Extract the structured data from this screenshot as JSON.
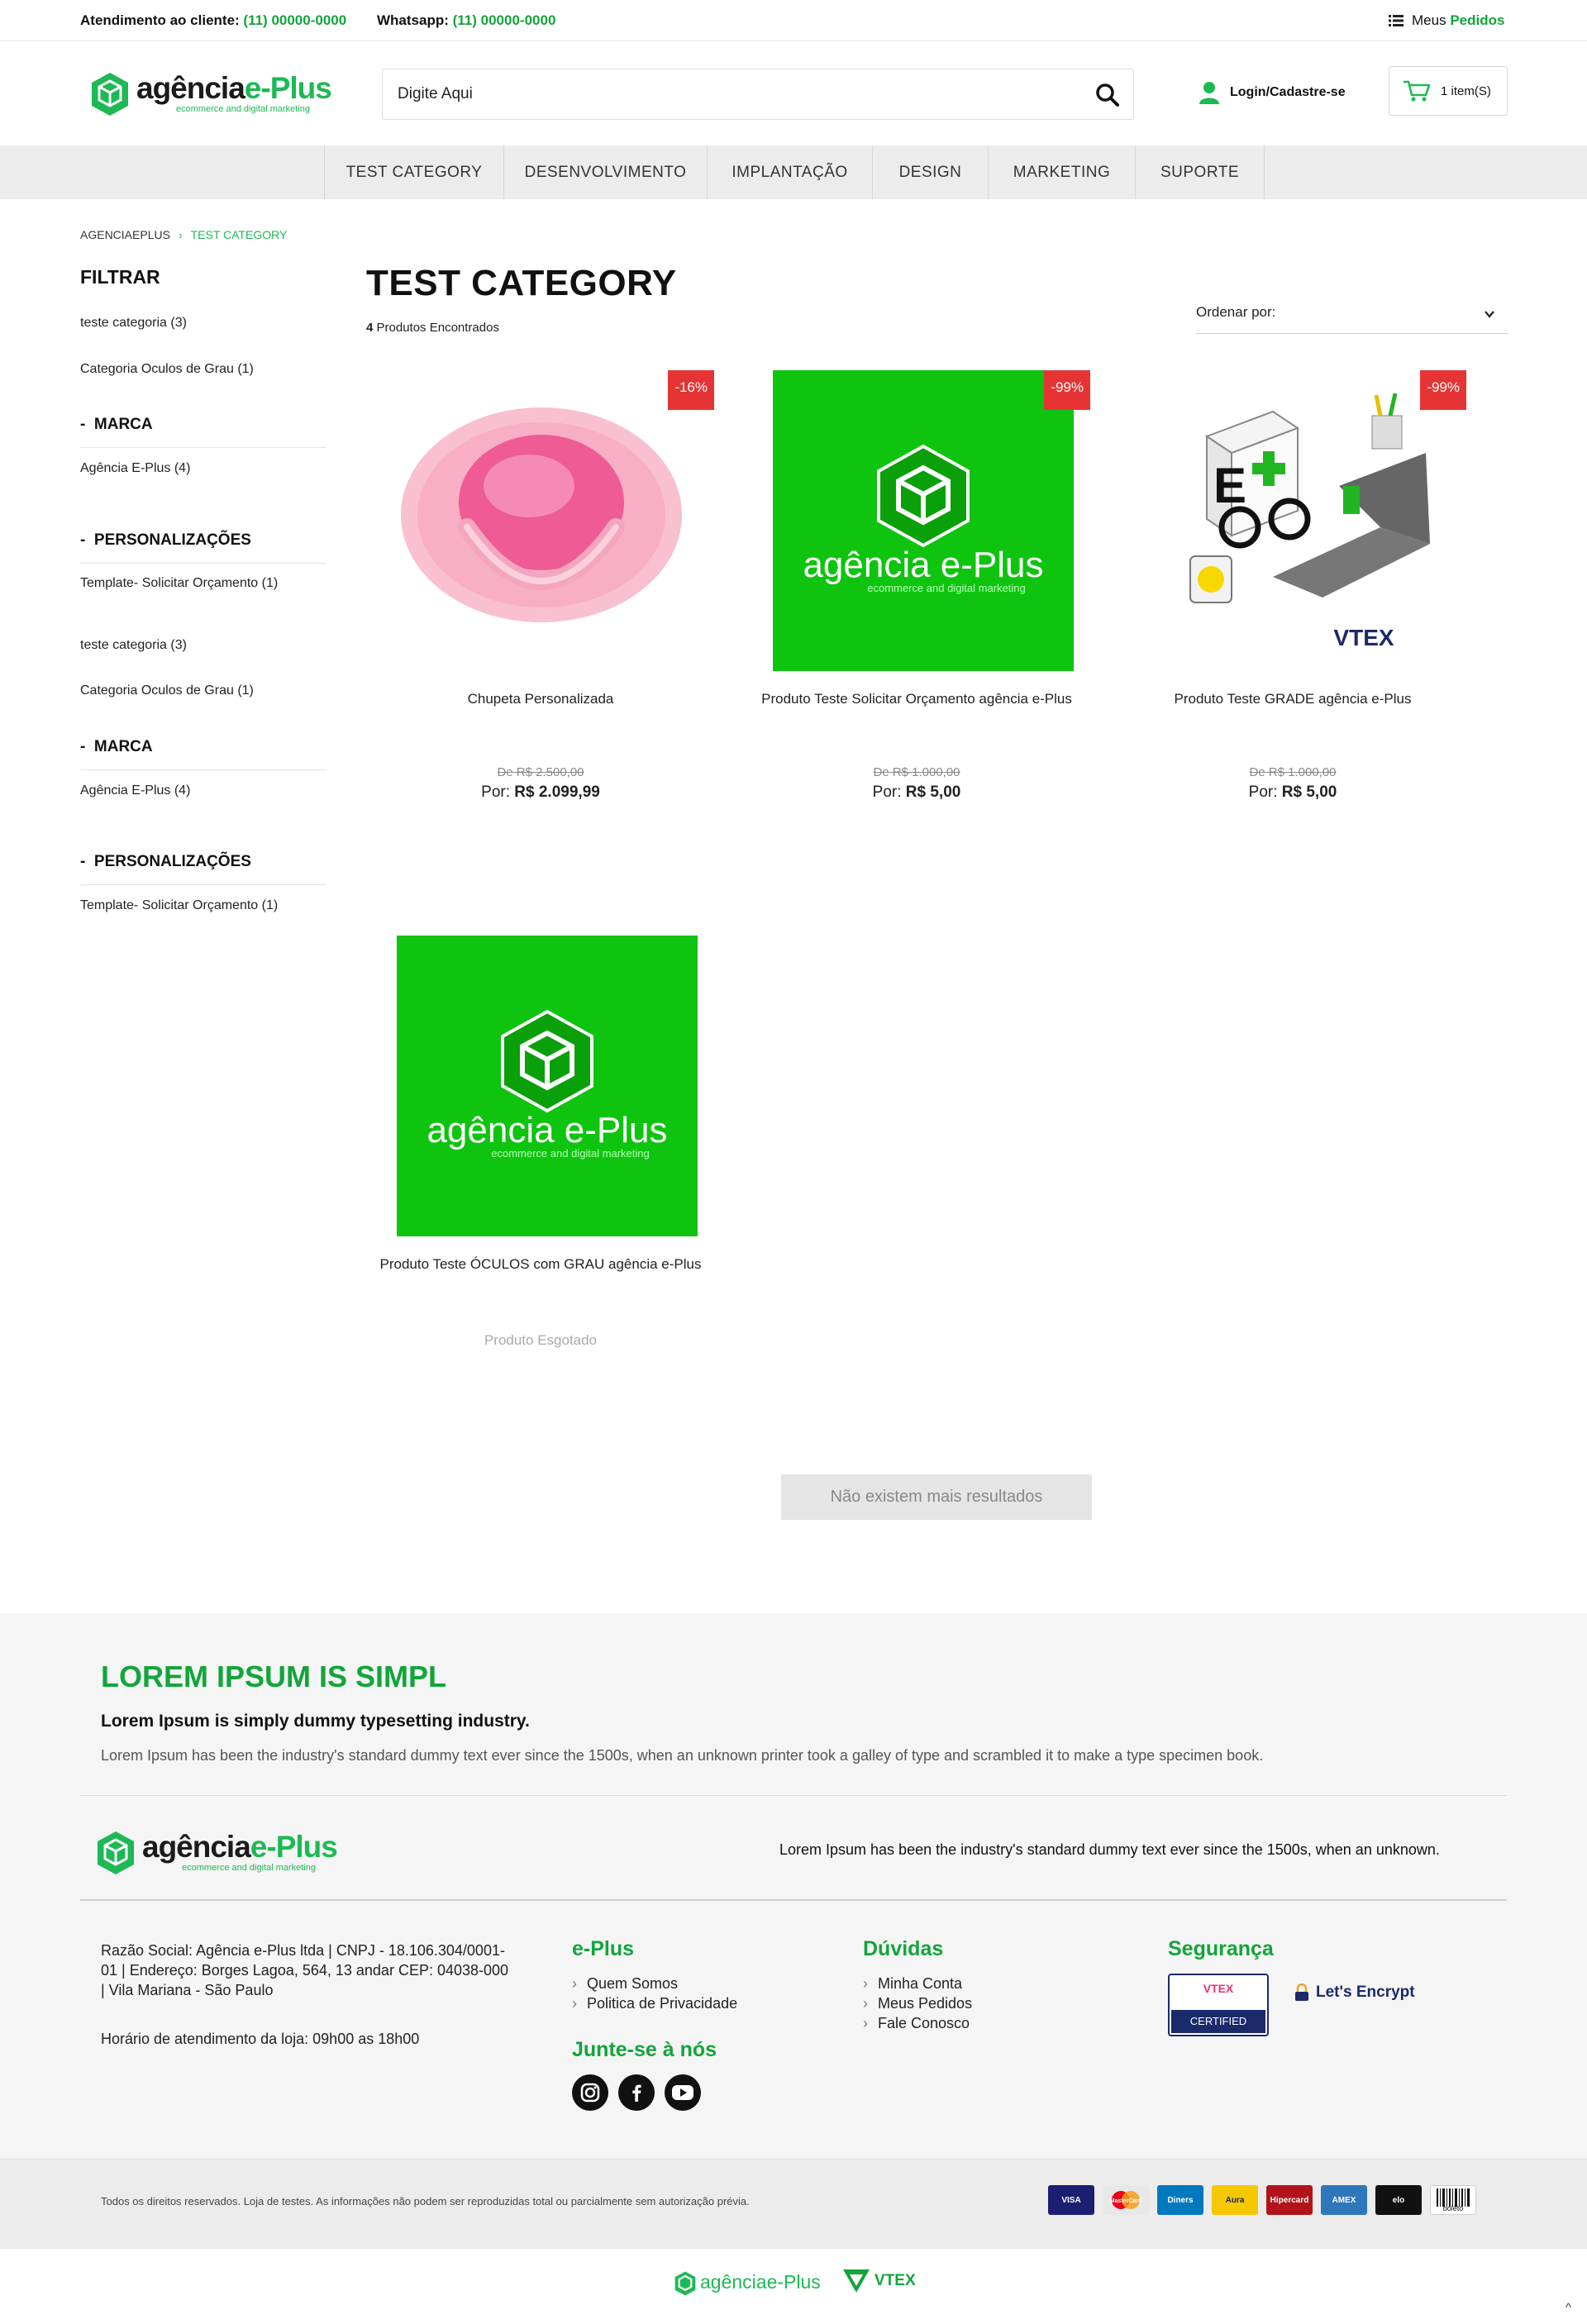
{
  "topbar": {
    "service_label": "Atendimento ao cliente:",
    "service_phone": "(11) 00000-0000",
    "whatsapp_label": "Whatsapp:",
    "whatsapp_phone": "(11) 00000-0000",
    "orders_prefix": "Meus",
    "orders_label": "Pedidos"
  },
  "header": {
    "logo_text_main": "agência",
    "logo_text_accent": "e-Plus",
    "logo_tagline": "ecommerce and digital marketing",
    "search_placeholder": "Digite Aqui",
    "login_label": "Login/Cadastre-se",
    "cart_label": "1 item(S)"
  },
  "nav": [
    "TEST CATEGORY",
    "DESENVOLVIMENTO",
    "IMPLANTAÇÃO",
    "DESIGN",
    "MARKETING",
    "SUPORTE"
  ],
  "breadcrumb": {
    "home": "AGENCIAEPLUS",
    "sep": "›",
    "current": "TEST CATEGORY"
  },
  "sidebar": {
    "title": "FILTRAR",
    "cat1": "teste categoria (3)",
    "cat2": "Categoria Oculos de Grau (1)",
    "brand_head": "MARCA",
    "brand_item": "Agência E-Plus (4)",
    "pers_head": "PERSONALIZAÇÕES",
    "pers_item": "Template- Solicitar Orçamento (1)",
    "dash": "-"
  },
  "main": {
    "title": "TEST CATEGORY",
    "found_count": "4",
    "found_label": "Produtos Encontrados",
    "order_label": "Ordenar por:",
    "no_more": "Não existem mais resultados"
  },
  "products": [
    {
      "name": "Chupeta Personalizada",
      "badge": "-16%",
      "old": "De R$ 2.500,00",
      "por": "Por:",
      "price": "R$ 2.099,99"
    },
    {
      "name": "Produto Teste Solicitar Orçamento agência e-Plus",
      "badge": "-99%",
      "old": "De R$ 1.000,00",
      "por": "Por:",
      "price": "R$ 5,00"
    },
    {
      "name": "Produto Teste GRADE agência e-Plus",
      "badge": "-99%",
      "old": "De R$ 1.000,00",
      "por": "Por:",
      "price": "R$ 5,00"
    },
    {
      "name": "Produto Teste ÓCULOS com GRAU agência e-Plus",
      "soldout": "Produto Esgotado"
    }
  ],
  "footer": {
    "heading": "LOREM IPSUM IS SIMPL",
    "subheading": "Lorem Ipsum is simply dummy typesetting industry.",
    "paragraph": "Lorem Ipsum has been the industry's standard dummy text ever since the 1500s, when an unknown printer took a galley of type and scrambled it to make a type specimen book.",
    "tagline": "Lorem Ipsum has been the industry's standard dummy text ever since the 1500s, when an unknown.",
    "company": "Razão Social: Agência e-Plus ltda | CNPJ - 18.106.304/0001-01 | Endereço: Borges Lagoa, 564, 13 andar CEP: 04038-000 | Vila Mariana - São Paulo",
    "hours": "Horário de atendimento da loja: 09h00 as 18h00",
    "col_eplus": "e-Plus",
    "eplus_links": [
      "Quem Somos",
      "Politica de Privacidade"
    ],
    "col_join": "Junte-se à nós",
    "col_help": "Dúvidas",
    "help_links": [
      "Minha Conta",
      "Meus Pedidos",
      "Fale Conosco"
    ],
    "col_sec": "Segurança",
    "vtex_pci": "VTEX",
    "pci_certified": "CERTIFIED",
    "letsencrypt": "Let's Encrypt",
    "copyright": "Todos os direitos reservados. Loja de testes. As informações não podem ser reproduzidas total ou parcialmente sem autorização prévia.",
    "payments": [
      "VISA",
      "MasterCard",
      "Diners",
      "Aura",
      "Hipercard",
      "AMEX",
      "elo",
      "boleto"
    ],
    "bottom_vtex": "VTEX",
    "totop": "^"
  },
  "colors": {
    "brand_green": "#1db954",
    "accent_green": "#12a53a",
    "badge_red": "#e63434",
    "product_bg_green": "#0ec40e"
  }
}
